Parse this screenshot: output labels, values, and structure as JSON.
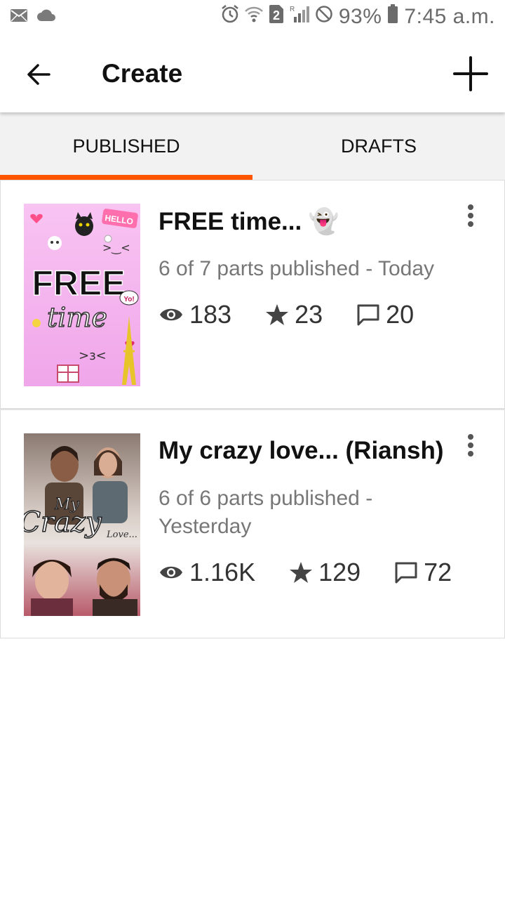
{
  "status_bar": {
    "battery_pct": "93%",
    "time": "7:45 a.m.",
    "sim_badge": "2",
    "left_icons": [
      "mail-icon",
      "cloud-icon"
    ],
    "right_icons": [
      "alarm-icon",
      "wifi-icon",
      "sim-icon",
      "signal-icon",
      "do-not-disturb-icon",
      "battery-icon"
    ]
  },
  "app_bar": {
    "title": "Create",
    "back_icon": "arrow-left-icon",
    "add_icon": "plus-icon"
  },
  "tabs": [
    {
      "label": "PUBLISHED",
      "active": true
    },
    {
      "label": "DRAFTS",
      "active": false
    }
  ],
  "accent_color": "#ff5500",
  "stories": [
    {
      "title": "FREE time... 👻",
      "meta": "6 of 7 parts published - Today",
      "views": "183",
      "votes": "23",
      "comments": "20",
      "cover_text": [
        "FREE",
        "time",
        "HELLO",
        "Yo!"
      ]
    },
    {
      "title": "My crazy love... (Riansh)",
      "meta": "6 of 6 parts published - Yesterday",
      "views": "1.16K",
      "votes": "129",
      "comments": "72",
      "cover_text": [
        "My",
        "Crazy",
        "Love..."
      ]
    }
  ]
}
